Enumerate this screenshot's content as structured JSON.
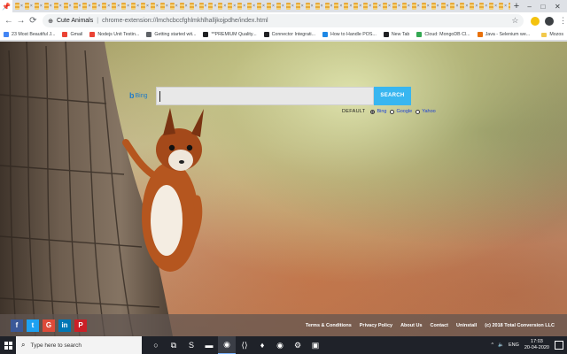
{
  "window": {
    "active_tab_icon": "pin-icon",
    "inactive_tab_count": 58,
    "new_tab_symbol": "+",
    "controls": [
      "–",
      "□",
      "✕"
    ]
  },
  "toolbar": {
    "back": "←",
    "forward": "→",
    "reload": "⟳",
    "site_name": "Cute Animals",
    "url": "chrome-extension://lmchcbccfghlmkhlhalljkojpdhe/index.html",
    "star": "☆",
    "menu": "⋮"
  },
  "bookmarks": {
    "items": [
      {
        "label": "23 Most Beautiful J...",
        "color": "#4285f4"
      },
      {
        "label": "Gmail",
        "color": "#ea4335"
      },
      {
        "label": "Nodejs Unit Testin...",
        "color": "#ea4335"
      },
      {
        "label": "Getting started wit...",
        "color": "#5f6368"
      },
      {
        "label": "**PREMIUM Quality...",
        "color": "#202124"
      },
      {
        "label": "Connector Integrati...",
        "color": "#202124"
      },
      {
        "label": "How to Handle POS...",
        "color": "#1e88e5"
      },
      {
        "label": "New Tab",
        "color": "#202124"
      },
      {
        "label": "Cloud: MongoDB Cl...",
        "color": "#34a853"
      },
      {
        "label": "Java - Selenium we...",
        "color": "#e8710a"
      }
    ],
    "other": "Mozos"
  },
  "search": {
    "provider_logo": "Bing",
    "button_label": "SEARCH",
    "default_label": "DEFAULT",
    "engines": [
      "Bing",
      "Google",
      "Yahoo"
    ],
    "selected_engine": "Bing"
  },
  "footer": {
    "social": [
      {
        "name": "facebook",
        "glyph": "f",
        "color": "#3b5998"
      },
      {
        "name": "twitter",
        "glyph": "t",
        "color": "#1da1f2"
      },
      {
        "name": "google",
        "glyph": "G",
        "color": "#dd4b39"
      },
      {
        "name": "linkedin",
        "glyph": "in",
        "color": "#0077b5"
      },
      {
        "name": "pinterest",
        "glyph": "P",
        "color": "#cb2027"
      }
    ],
    "links": [
      "Terms & Conditions",
      "Privacy Policy",
      "About Us",
      "Contact",
      "Uninstall",
      "(c) 2018 Total Conversion LLC"
    ]
  },
  "taskbar": {
    "search_placeholder": "Type here to search",
    "apps": [
      {
        "name": "cortana",
        "glyph": "○"
      },
      {
        "name": "task-view",
        "glyph": "⧉"
      },
      {
        "name": "snipping",
        "glyph": "S"
      },
      {
        "name": "file-explorer",
        "glyph": "▬"
      },
      {
        "name": "chrome",
        "glyph": "◉",
        "active": true
      },
      {
        "name": "vscode",
        "glyph": "⟨⟩"
      },
      {
        "name": "git",
        "glyph": "♦"
      },
      {
        "name": "chrome-2",
        "glyph": "◉"
      },
      {
        "name": "settings",
        "glyph": "⚙"
      },
      {
        "name": "terminal",
        "glyph": "▣"
      }
    ],
    "tray_items": [
      "^",
      "🔈",
      "ENG"
    ],
    "time": "17:03",
    "date": "20-04-2020"
  },
  "colors": {
    "search_button": "#38b6f0",
    "footer_bg": "rgba(95,85,80,0.72)",
    "taskbar_bg": "#1f2229"
  }
}
